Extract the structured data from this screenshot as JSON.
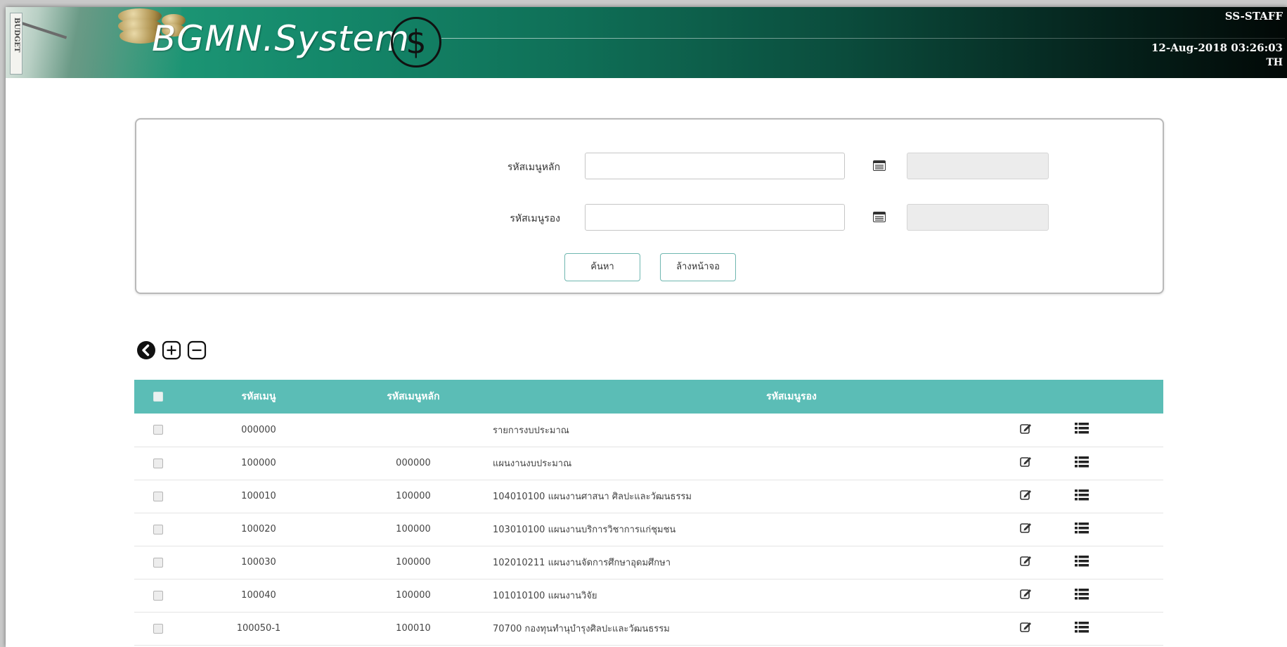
{
  "header": {
    "app_title": "BGMN.System",
    "currency_symbol": "$",
    "side_label": "BUDGET",
    "user": "SS-STAFF",
    "datetime": "12-Aug-2018 03:26:03",
    "language": "TH",
    "accent_color": "#14886a"
  },
  "search": {
    "main_code_label": "รหัสเมนูหลัก",
    "main_code_value": "",
    "sub_code_label": "รหัสเมนูรอง",
    "sub_code_value": "",
    "lookup_icon": "list-window-icon",
    "search_button": "ค้นหา",
    "clear_button": "ล้างหน้าจอ"
  },
  "toolbar": {
    "icons": [
      "back-circle-icon",
      "expand-plus-icon",
      "collapse-minus-icon"
    ]
  },
  "table": {
    "header_color": "#5bbdb6",
    "columns": [
      "รหัสเมนู",
      "รหัสเมนูหลัก",
      "รหัสเมนูรอง"
    ],
    "rows": [
      {
        "code": "000000",
        "main": "",
        "sub": "รายการงบประมาณ"
      },
      {
        "code": "100000",
        "main": "000000",
        "sub": "แผนงานงบประมาณ"
      },
      {
        "code": "100010",
        "main": "100000",
        "sub": "104010100 แผนงานศาสนา ศิลปะและวัฒนธรรม"
      },
      {
        "code": "100020",
        "main": "100000",
        "sub": "103010100 แผนงานบริการวิชาการแก่ชุมชน"
      },
      {
        "code": "100030",
        "main": "100000",
        "sub": "102010211 แผนงานจัดการศึกษาอุดมศึกษา"
      },
      {
        "code": "100040",
        "main": "100000",
        "sub": "101010100 แผนงานวิจัย"
      },
      {
        "code": "100050-1",
        "main": "100010",
        "sub": "70700 กองทุนทำนุบำรุงศิลปะและวัฒนธรรม"
      }
    ],
    "row_icons": [
      "edit-icon",
      "list-icon"
    ]
  }
}
